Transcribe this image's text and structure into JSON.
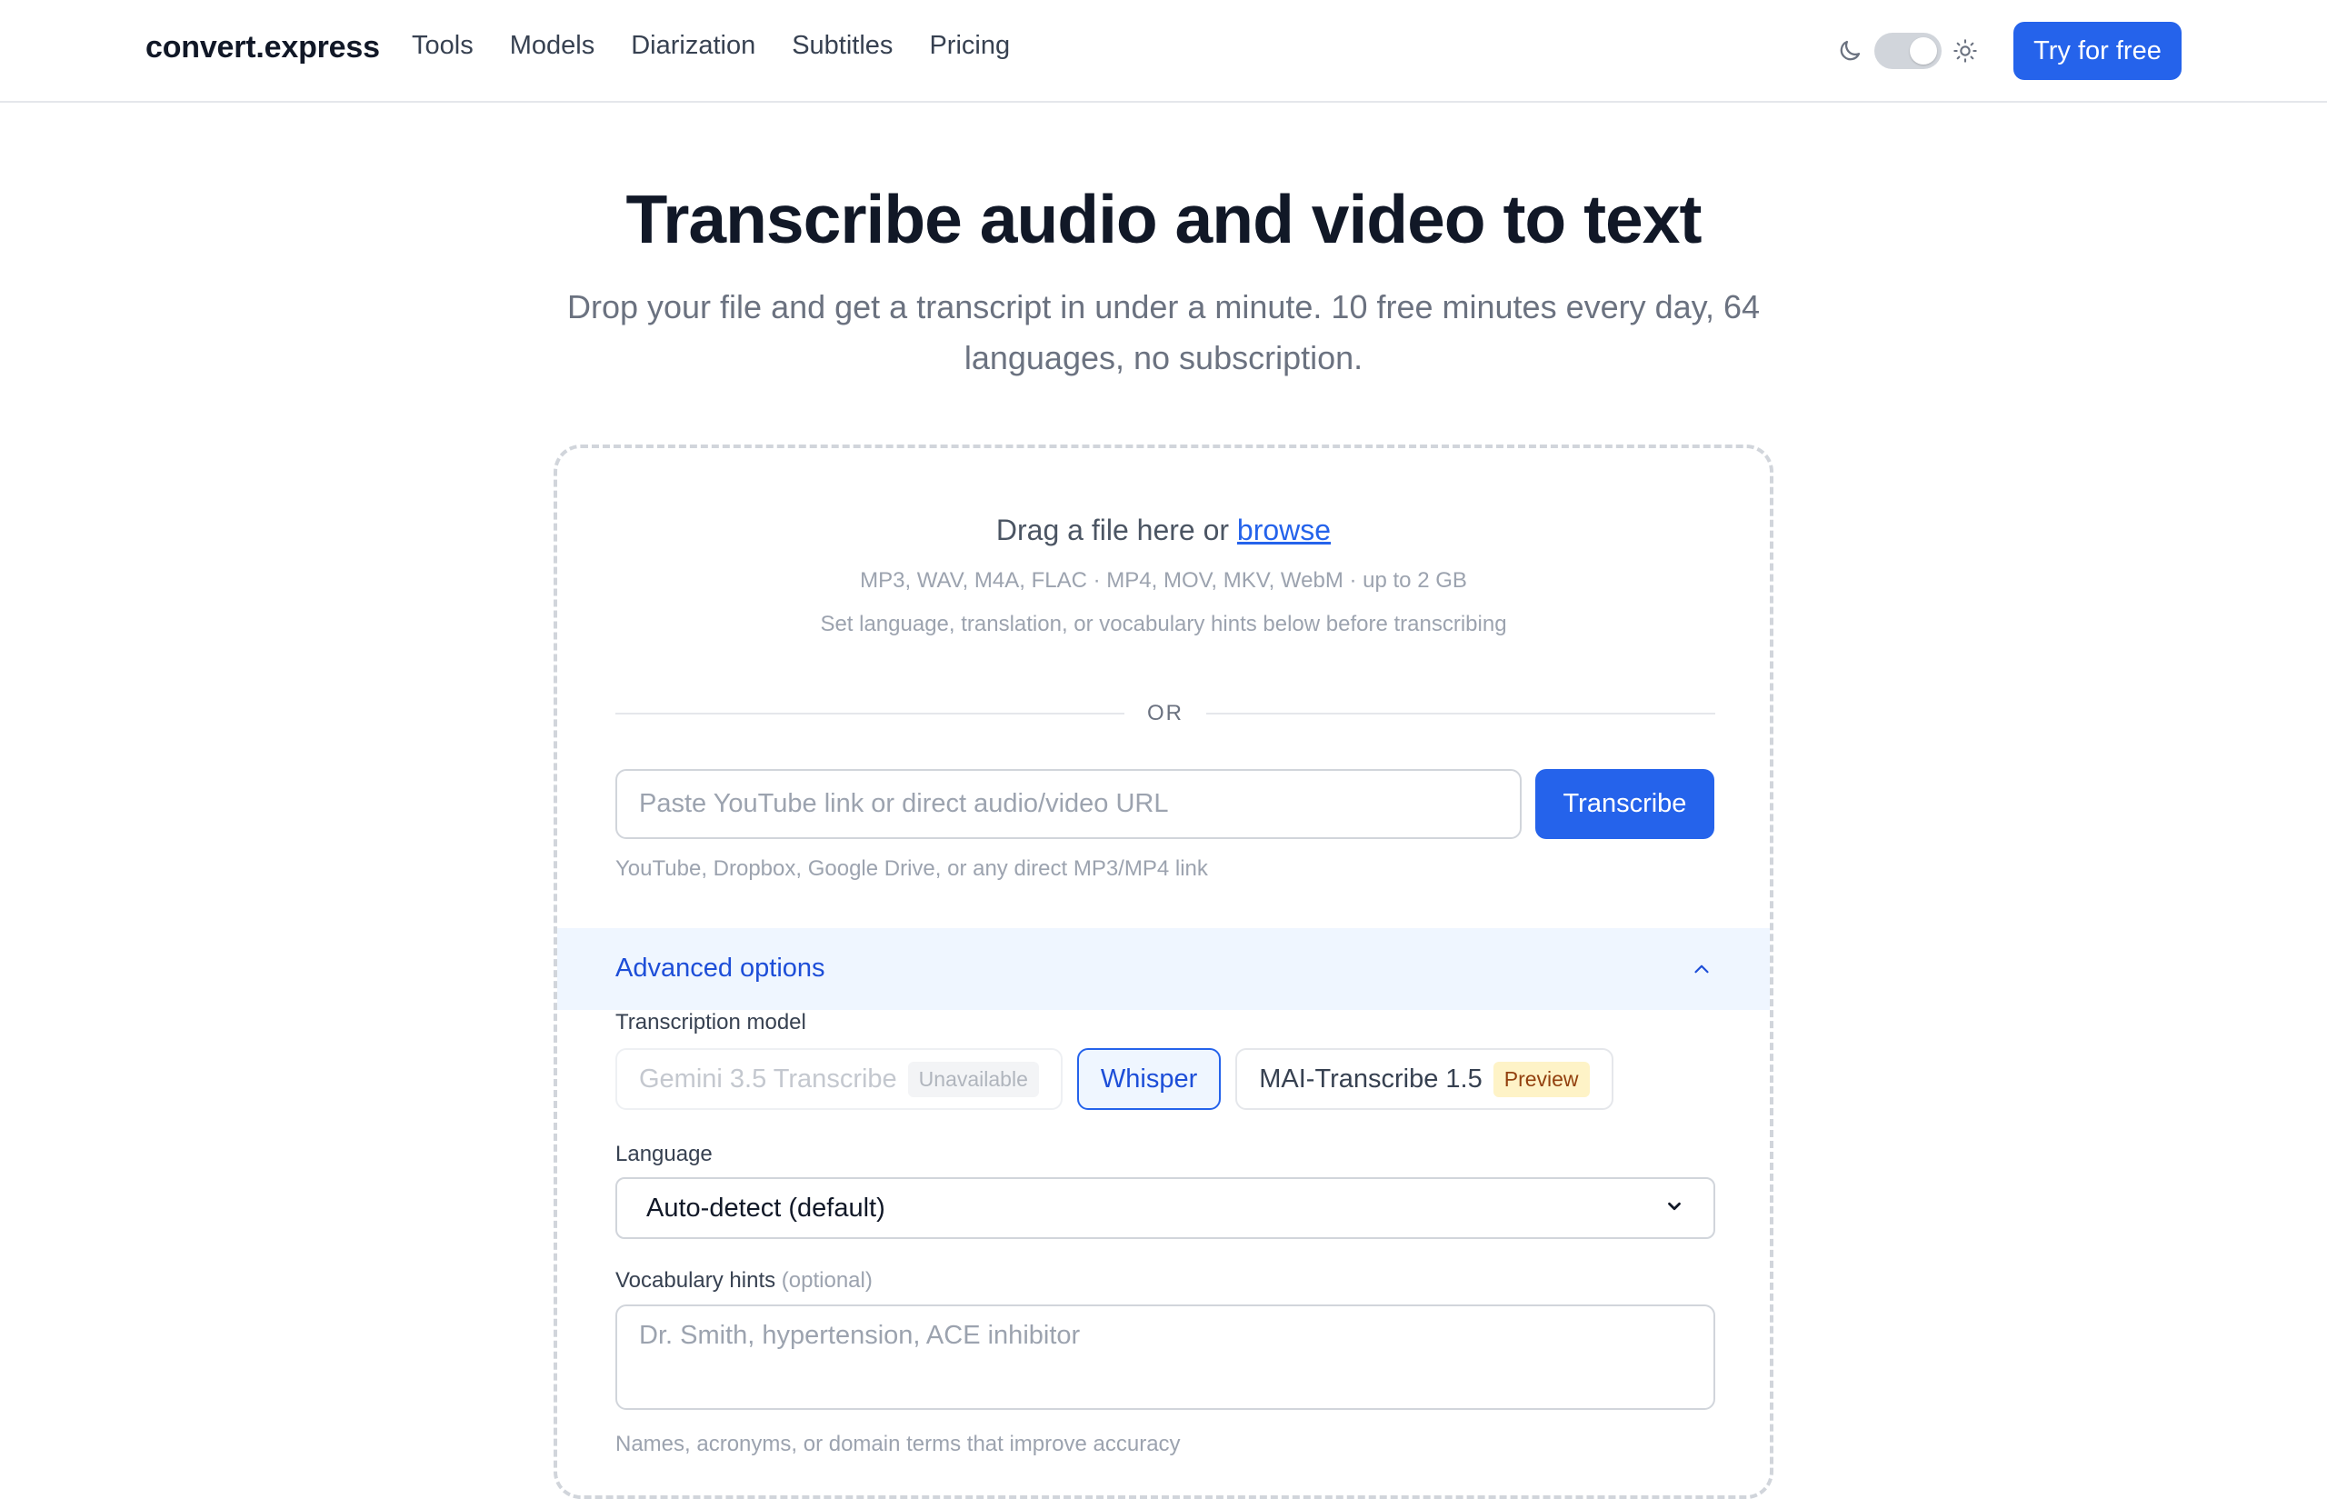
{
  "header": {
    "logo": "convert.express",
    "nav": [
      "Tools",
      "Models",
      "Diarization",
      "Subtitles",
      "Pricing"
    ],
    "theme_toggle": {
      "icons": [
        "moon-icon",
        "sun-icon"
      ],
      "state": "light"
    },
    "cta_label": "Try for free"
  },
  "hero": {
    "title": "Transcribe audio and video to text",
    "subtitle": "Drop your file and get a transcript in under a minute. 10 free minutes every day, 64 languages, no subscription."
  },
  "upload": {
    "drop_text": "Drag a file here or ",
    "browse_label": "browse",
    "formats": "MP3, WAV, M4A, FLAC · MP4, MOV, MKV, WebM · up to 2 GB",
    "hint": "Set language, translation, or vocabulary hints below before transcribing",
    "or_label": "OR",
    "url_placeholder": "Paste YouTube link or direct audio/video URL",
    "url_value": "",
    "transcribe_label": "Transcribe",
    "url_hint": "YouTube, Dropbox, Google Drive, or any direct MP3/MP4 link"
  },
  "advanced": {
    "label": "Advanced options",
    "expanded": true,
    "model_label": "Transcription model",
    "models": [
      {
        "name": "Gemini 3.5 Transcribe",
        "badge": "Unavailable",
        "state": "disabled"
      },
      {
        "name": "Whisper",
        "badge": "",
        "state": "selected"
      },
      {
        "name": "MAI-Transcribe 1.5",
        "badge": "Preview",
        "state": "available"
      }
    ],
    "language_label": "Language",
    "language_value": "Auto-detect (default)",
    "vocab_label": "Vocabulary hints",
    "vocab_optional": "(optional)",
    "vocab_placeholder": "Dr. Smith, hypertension, ACE inhibitor",
    "vocab_value": "",
    "vocab_hint": "Names, acronyms, or domain terms that improve accuracy"
  },
  "colors": {
    "accent": "#2563eb",
    "accent_light_bg": "#eff6ff",
    "preview_badge_bg": "#fef3c7",
    "text_muted": "#9ca3af"
  }
}
